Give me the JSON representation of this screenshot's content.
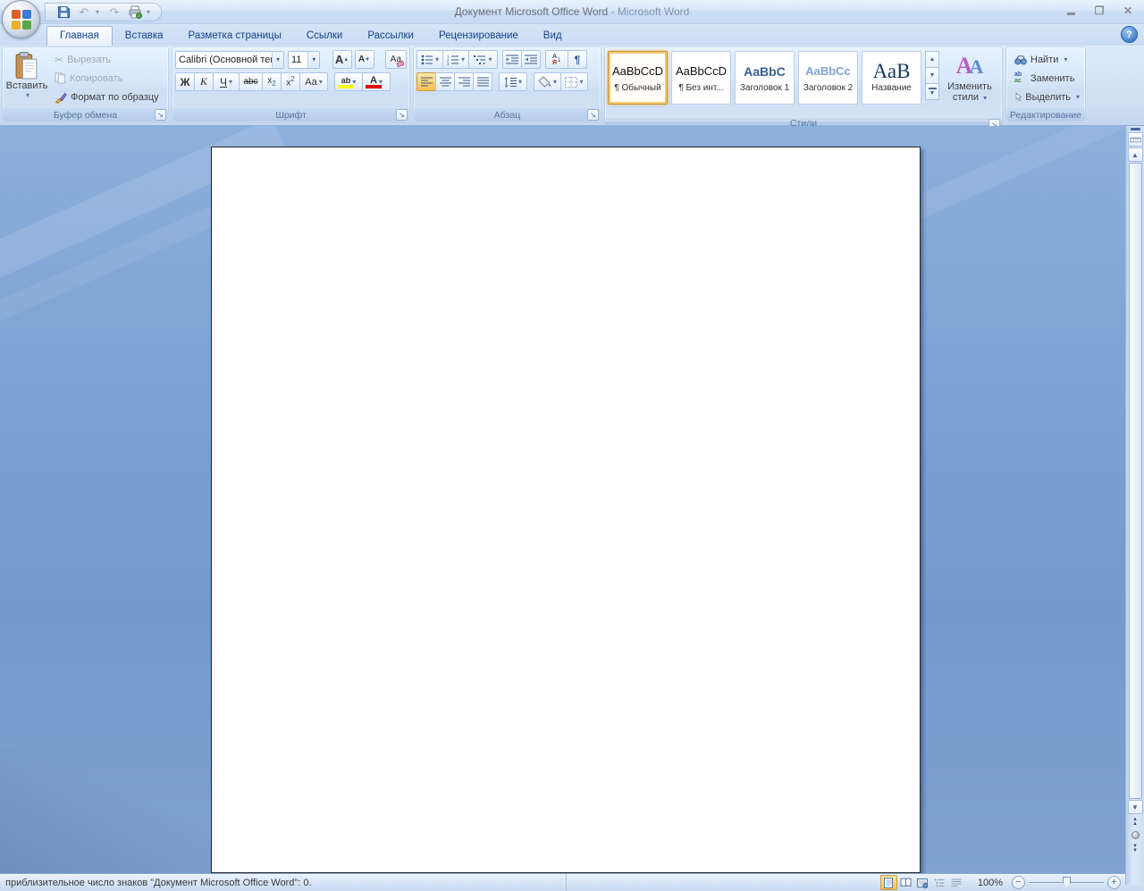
{
  "titlebar": {
    "doc_title": "Документ Microsoft Office Word",
    "separator": "-",
    "app_name": "Microsoft Word"
  },
  "tabs": [
    {
      "label": "Главная",
      "active": true
    },
    {
      "label": "Вставка",
      "active": false
    },
    {
      "label": "Разметка страницы",
      "active": false
    },
    {
      "label": "Ссылки",
      "active": false
    },
    {
      "label": "Рассылки",
      "active": false
    },
    {
      "label": "Рецензирование",
      "active": false
    },
    {
      "label": "Вид",
      "active": false
    }
  ],
  "ribbon": {
    "clipboard": {
      "group_label": "Буфер обмена",
      "paste": "Вставить",
      "cut": "Вырезать",
      "copy": "Копировать",
      "format_painter": "Формат по образцу"
    },
    "font": {
      "group_label": "Шрифт",
      "font_name": "Calibri (Основной тек",
      "font_size": "11",
      "grow_font": "А",
      "shrink_font": "А",
      "clear_formatting": "Аа",
      "bold": "Ж",
      "italic": "К",
      "underline": "Ч",
      "strikethrough": "abc",
      "subscript_base": "x",
      "subscript_mark": "2",
      "superscript_base": "x",
      "superscript_mark": "2",
      "change_case": "Аа",
      "highlight": "ab",
      "font_color": "А"
    },
    "paragraph": {
      "group_label": "Абзац",
      "sort_top": "А",
      "sort_bottom": "Я"
    },
    "styles": {
      "group_label": "Стили",
      "items": [
        {
          "preview": "AaBbCcD",
          "label": "¶ Обычный",
          "selected": true
        },
        {
          "preview": "AaBbCcD",
          "label": "¶ Без инт...",
          "selected": false
        },
        {
          "preview": "AaBbC",
          "label": "Заголовок 1",
          "selected": false
        },
        {
          "preview": "AaBbCc",
          "label": "Заголовок 2",
          "selected": false
        },
        {
          "preview": "АаВ",
          "label": "Название",
          "selected": false
        }
      ],
      "change_styles_line1": "Изменить",
      "change_styles_line2": "стили"
    },
    "editing": {
      "group_label": "Редактирование",
      "find": "Найти",
      "replace": "Заменить",
      "select": "Выделить"
    }
  },
  "document": {
    "content": ""
  },
  "status_bar": {
    "text": "приблизительное число знаков \"Документ Microsoft Office Word\": 0.",
    "zoom_level": "100%"
  },
  "icons": {
    "dropdown": "▾",
    "scissors": "✂",
    "undo": "↶",
    "redo": "↷",
    "pilcrow": "¶",
    "dialog_launcher": "↘",
    "restore": "❐",
    "close": "✕",
    "help": "?",
    "up": "▲",
    "down": "▼",
    "minus": "−",
    "plus": "+",
    "sort_arrow": "↓"
  },
  "colors": {
    "accent_orange": "#fcc050",
    "heading1": "#365f91",
    "heading2": "#7da5d8",
    "title_style": "#17365d",
    "tab_text": "#15428b",
    "desktop_blue": "#7499cc"
  }
}
